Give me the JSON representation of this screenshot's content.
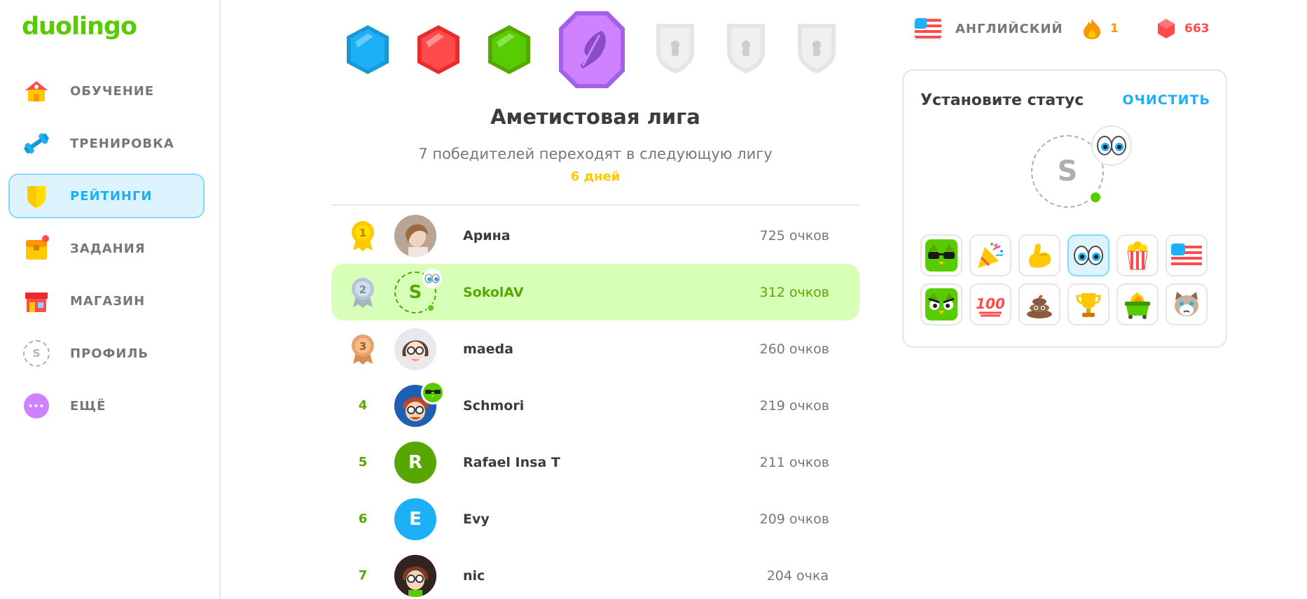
{
  "brand": {
    "logo": "duolingo"
  },
  "nav": [
    {
      "label": "ОБУЧЕНИЕ",
      "icon": "home-icon"
    },
    {
      "label": "ТРЕНИРОВКА",
      "icon": "dumbbell-icon"
    },
    {
      "label": "РЕЙТИНГИ",
      "icon": "shield-icon",
      "active": true
    },
    {
      "label": "ЗАДАНИЯ",
      "icon": "chest-icon"
    },
    {
      "label": "МАГАЗИН",
      "icon": "shop-icon"
    },
    {
      "label": "ПРОФИЛЬ",
      "icon": "profile-icon",
      "initial": "S"
    },
    {
      "label": "ЕЩЁ",
      "icon": "more-icon",
      "glyph": "•••"
    }
  ],
  "league": {
    "title": "Аметистовая лига",
    "subtitle": "7 победителей переходят в следующую лигу",
    "days": "6 дней",
    "badge_colors": [
      "#1cb0f6",
      "#ff4b4b",
      "#58cc02",
      "#ce82ff",
      "#e5e5e5",
      "#e5e5e5",
      "#e5e5e5"
    ]
  },
  "leaderboard": [
    {
      "rank": "1",
      "name": "Арина",
      "xp": "725 очков",
      "medal": "gold"
    },
    {
      "rank": "2",
      "name": "SokolAV",
      "xp": "312 очков",
      "medal": "silver",
      "me": true,
      "initial": "S"
    },
    {
      "rank": "3",
      "name": "maeda",
      "xp": "260 очков",
      "medal": "bronze"
    },
    {
      "rank": "4",
      "name": "Schmori",
      "xp": "219 очков"
    },
    {
      "rank": "5",
      "name": "Rafael Insa T",
      "xp": "211 очков",
      "initial": "R",
      "color": "#58a700"
    },
    {
      "rank": "6",
      "name": "Evy",
      "xp": "209 очков",
      "initial": "E",
      "color": "#1cb0f6"
    },
    {
      "rank": "7",
      "name": "nic",
      "xp": "204 очка"
    }
  ],
  "topbar": {
    "language": "АНГЛИЙСКИЙ",
    "streak": "1",
    "gems": "663"
  },
  "status": {
    "title": "Установите статус",
    "clear": "ОЧИСТИТЬ",
    "initial": "S",
    "emoji": [
      "sunglasses-owl-icon",
      "party-popper-icon",
      "flexed-biceps-icon",
      "eyes-icon",
      "popcorn-icon",
      "us-flag-icon",
      "angry-owl-icon",
      "hundred-points-icon",
      "poop-icon",
      "trophy-icon",
      "dumpster-fire-icon",
      "grumpy-cat-icon"
    ],
    "selected_index": 3
  }
}
